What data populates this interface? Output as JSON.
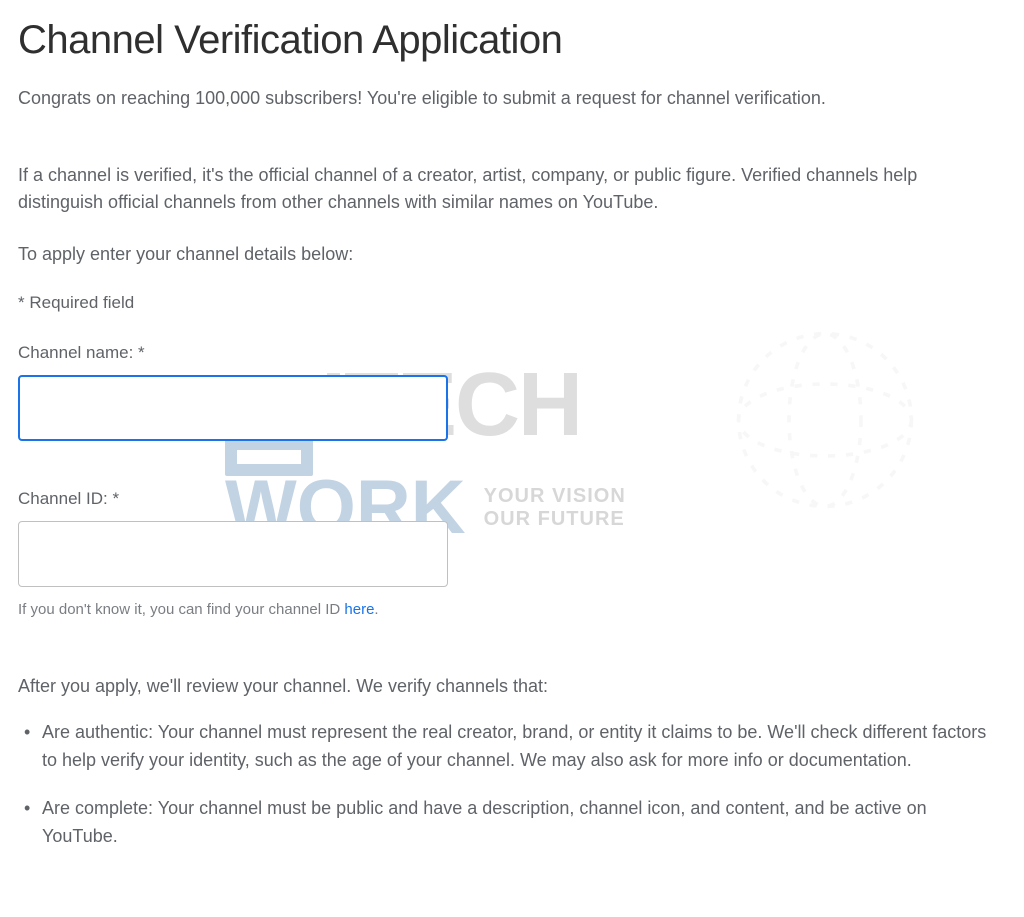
{
  "page": {
    "title": "Channel Verification Application",
    "intro": "Congrats on reaching 100,000 subscribers! You're eligible to submit a request for channel verification.",
    "description": "If a channel is verified, it's the official channel of a creator, artist, company, or public figure. Verified channels help distinguish official channels from other channels with similar names on YouTube.",
    "apply_instruction": "To apply enter your channel details below:",
    "required_note": "* Required field"
  },
  "form": {
    "channel_name": {
      "label": "Channel name: *",
      "value": ""
    },
    "channel_id": {
      "label": "Channel ID: *",
      "value": "",
      "hint_prefix": "If you don't know it, you can find your channel ID ",
      "hint_link_text": "here",
      "hint_suffix": "."
    }
  },
  "review": {
    "after_apply": "After you apply, we'll review your channel. We verify channels that:",
    "criteria": [
      "Are authentic: Your channel must represent the real creator, brand, or entity it claims to be. We'll check different factors to help verify your identity, such as the age of your channel. We may also ask for more info or documentation.",
      "Are complete: Your channel must be public and have a description, channel icon, and content, and be active on YouTube."
    ]
  },
  "watermark": {
    "line1": "ITECH",
    "line2": "WORK",
    "tag1": "YOUR VISION",
    "tag2": "OUR FUTURE"
  }
}
